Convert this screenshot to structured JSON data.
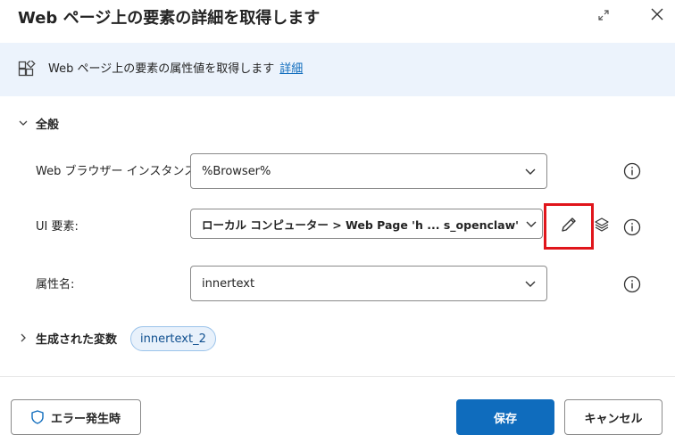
{
  "dialog": {
    "title": "Web ページ上の要素の詳細を取得します"
  },
  "info": {
    "text": "Web ページ上の要素の属性値を取得します",
    "link_label": "詳細"
  },
  "general": {
    "section_label": "全般",
    "fields": {
      "browser_instance": {
        "label": "Web ブラウザー インスタンス:",
        "value": "%Browser%"
      },
      "ui_element": {
        "label": "UI 要素:",
        "value": "ローカル コンピューター > Web Page 'h ... s_openclaw' > H"
      },
      "attribute_name": {
        "label": "属性名:",
        "value": "innertext"
      }
    }
  },
  "variables": {
    "section_label": "生成された変数",
    "chip": "innertext_2"
  },
  "footer": {
    "on_error_label": "エラー発生時",
    "save_label": "保存",
    "cancel_label": "キャンセル"
  },
  "colors": {
    "accent": "#0f6cbd",
    "info_background": "#ecf3fc",
    "highlight": "#e0151b"
  }
}
